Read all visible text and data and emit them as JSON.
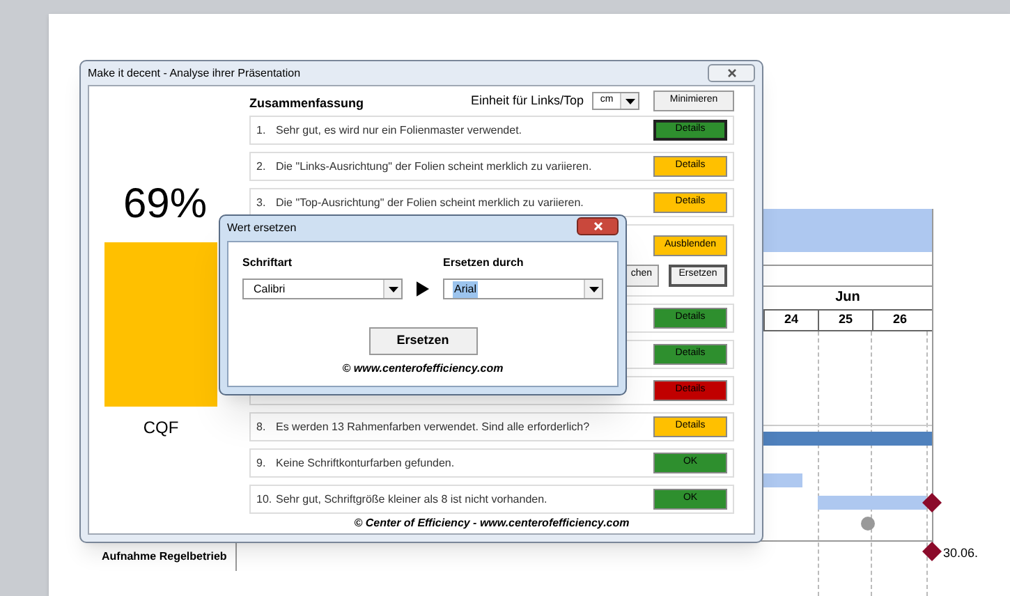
{
  "background_slide": {
    "month": "Jun",
    "days": [
      "24",
      "25",
      "26"
    ],
    "task_label": "Aufnahme Regelbetrieb",
    "milestone_date": "30.06."
  },
  "main_dialog": {
    "title": "Make it decent - Analyse ihrer Präsentation",
    "score": "69%",
    "score_label": "CQF",
    "heading": "Zusammenfassung",
    "unit_label": "Einheit für Links/Top",
    "unit_value": "cm",
    "minimize_button": "Minimieren",
    "footer": "© Center of Efficiency - www.centerofefficiency.com",
    "items": [
      {
        "kind": "result",
        "number": "1.",
        "text": "Sehr gut, es wird nur ein Folienmaster verwendet.",
        "button": "Details",
        "color": "#2e8f2e",
        "selected": true
      },
      {
        "kind": "result",
        "number": "2.",
        "text": "Die \"Links-Ausrichtung\" der Folien scheint merklich zu variieren.",
        "button": "Details",
        "color": "#ffc000",
        "selected": false
      },
      {
        "kind": "result",
        "number": "3.",
        "text": "Die \"Top-Ausrichtung\" der Folien scheint merklich zu variieren.",
        "button": "Details",
        "color": "#ffc000",
        "selected": false
      },
      {
        "kind": "actions",
        "button": "Ausblenden",
        "color": "#ffc000",
        "search_button": "chen",
        "replace_button": "Ersetzen"
      },
      {
        "kind": "result",
        "button": "Details",
        "color": "#2e8f2e",
        "selected": false
      },
      {
        "kind": "result",
        "button": "Details",
        "color": "#2e8f2e",
        "selected": false
      },
      {
        "kind": "result",
        "button": "Details",
        "color": "#c00000",
        "selected": false
      },
      {
        "kind": "result",
        "number": "8.",
        "text": "Es werden 13 Rahmenfarben verwendet. Sind alle erforderlich?",
        "button": "Details",
        "color": "#ffc000",
        "selected": false
      },
      {
        "kind": "result",
        "number": "9.",
        "text": "Keine Schriftkonturfarben gefunden.",
        "button": "OK",
        "color": "#2e8f2e",
        "selected": false
      },
      {
        "kind": "result",
        "number": "10.",
        "text": "Sehr gut, Schriftgröße kleiner als 8 ist nicht vorhanden.",
        "button": "OK",
        "color": "#2e8f2e",
        "selected": false
      }
    ]
  },
  "replace_dialog": {
    "title": "Wert ersetzen",
    "font_label": "Schriftart",
    "font_value": "Calibri",
    "replace_label": "Ersetzen durch",
    "replace_value": "Arial",
    "replace_button": "Ersetzen",
    "footer": "© www.centerofefficiency.com"
  }
}
